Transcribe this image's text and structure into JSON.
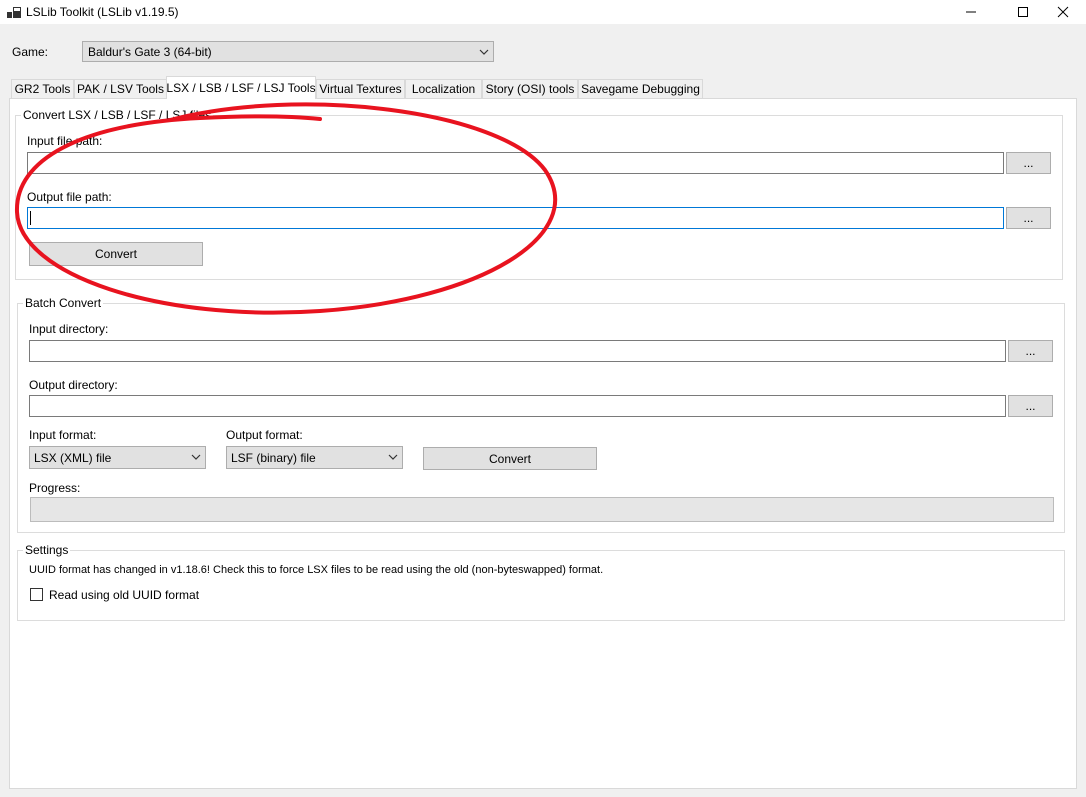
{
  "window": {
    "title": "LSLib Toolkit (LSLib v1.19.5)",
    "icons": {
      "app": "app-window-icon",
      "minimize": "minimize-icon",
      "maximize": "maximize-icon",
      "close": "close-icon"
    }
  },
  "game": {
    "label": "Game:",
    "selected": "Baldur's Gate 3 (64-bit)"
  },
  "tabs": [
    {
      "label": "GR2 Tools",
      "active": false
    },
    {
      "label": "PAK / LSV Tools",
      "active": false
    },
    {
      "label": "LSX / LSB / LSF / LSJ Tools",
      "active": true
    },
    {
      "label": "Virtual Textures",
      "active": false
    },
    {
      "label": "Localization",
      "active": false
    },
    {
      "label": "Story (OSI) tools",
      "active": false
    },
    {
      "label": "Savegame Debugging",
      "active": false
    }
  ],
  "convert": {
    "legend": "Convert LSX / LSB / LSF / LSJ files",
    "input_label": "Input file path:",
    "input_value": "",
    "output_label": "Output file path:",
    "output_value": "",
    "browse_label": "...",
    "convert_label": "Convert"
  },
  "batch": {
    "legend": "Batch Convert",
    "input_dir_label": "Input directory:",
    "input_dir_value": "",
    "output_dir_label": "Output directory:",
    "output_dir_value": "",
    "browse_label": "...",
    "input_format_label": "Input format:",
    "input_format_value": "LSX (XML) file",
    "output_format_label": "Output format:",
    "output_format_value": "LSF (binary) file",
    "convert_label": "Convert",
    "progress_label": "Progress:",
    "progress_value": 0
  },
  "settings": {
    "legend": "Settings",
    "note": "UUID format has changed in v1.18.6! Check this to force LSX files to be read using the old (non-byteswapped) format.",
    "checkbox_label": "Read using old UUID format",
    "checkbox_checked": false
  },
  "annotation": {
    "shape": "ellipse",
    "color": "#e8131f"
  }
}
